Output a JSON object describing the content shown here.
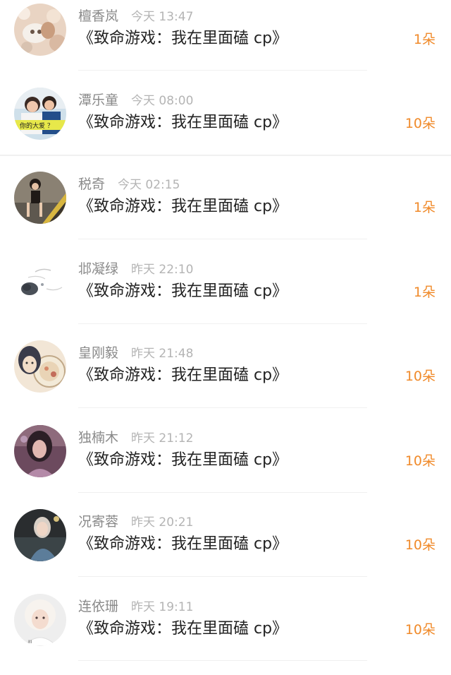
{
  "items": [
    {
      "name": "檀香岚",
      "time": "今天 13:47",
      "title": "《致命游戏：我在里面磕 cp》",
      "flowers": "1朵",
      "avatar_icon": "girl-dog-photo-icon"
    },
    {
      "name": "潭乐童",
      "time": "今天 08:00",
      "title": "《致命游戏：我在里面磕 cp》",
      "flowers": "10朵",
      "avatar_icon": "couple-photo-icon",
      "avatar_text": "你的大爱 ？"
    },
    {
      "name": "税奇",
      "time": "今天 02:15",
      "title": "《致命游戏：我在里面磕 cp》",
      "flowers": "1朵",
      "avatar_icon": "girl-stairs-photo-icon"
    },
    {
      "name": "邶凝绿",
      "time": "昨天 22:10",
      "title": "《致命游戏：我在里面磕 cp》",
      "flowers": "1朵",
      "avatar_icon": "ink-sketch-icon"
    },
    {
      "name": "皇刚毅",
      "time": "昨天 21:48",
      "title": "《致命游戏：我在里面磕 cp》",
      "flowers": "10朵",
      "avatar_icon": "anime-girl-fan-icon"
    },
    {
      "name": "独楠木",
      "time": "昨天 21:12",
      "title": "《致命游戏：我在里面磕 cp》",
      "flowers": "10朵",
      "avatar_icon": "girl-purple-photo-icon"
    },
    {
      "name": "况寄蓉",
      "time": "昨天 20:21",
      "title": "《致命游戏：我在里面磕 cp》",
      "flowers": "10朵",
      "avatar_icon": "girl-night-photo-icon"
    },
    {
      "name": "连依珊",
      "time": "昨天 19:11",
      "title": "《致命游戏：我在里面磕 cp》",
      "flowers": "10朵",
      "avatar_icon": "white-hair-girl-icon"
    }
  ],
  "colors": {
    "name": "#8a8a8a",
    "time": "#b4b4b4",
    "title": "#222222",
    "flowers": "#f08a2a",
    "divider": "#f0f0f0"
  }
}
